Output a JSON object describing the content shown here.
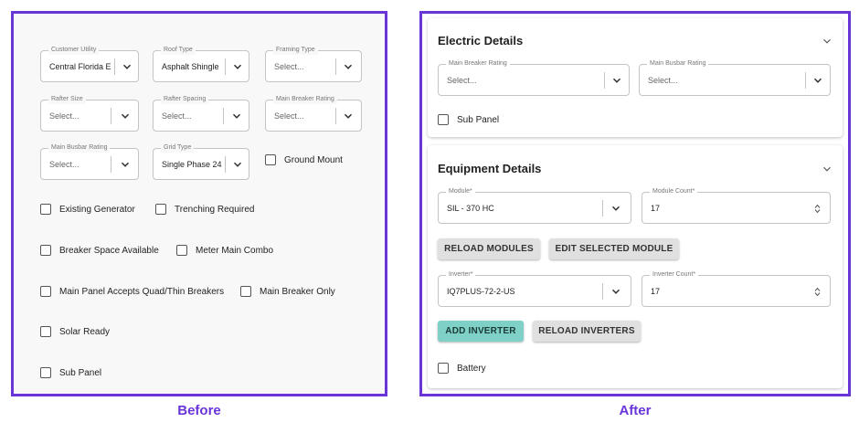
{
  "captions": {
    "before": "Before",
    "after": "After"
  },
  "before": {
    "selects": [
      {
        "label": "Customer Utility",
        "value": "Central Florida E..",
        "placeholder": false
      },
      {
        "label": "Roof Type",
        "value": "Asphalt Shingle",
        "placeholder": false
      },
      {
        "label": "Framing Type",
        "value": "Select...",
        "placeholder": true
      },
      {
        "label": "Rafter Size",
        "value": "Select...",
        "placeholder": true
      },
      {
        "label": "Rafter Spacing",
        "value": "Select...",
        "placeholder": true
      },
      {
        "label": "Main Breaker Rating",
        "value": "Select...",
        "placeholder": true
      },
      {
        "label": "Main Busbar Rating",
        "value": "Select...",
        "placeholder": true
      },
      {
        "label": "Grid Type",
        "value": "Single Phase 24..",
        "placeholder": false
      }
    ],
    "checkboxes": [
      "Ground Mount",
      "Existing Generator",
      "Trenching Required",
      "Breaker Space Available",
      "Meter Main Combo",
      "Main Panel Accepts Quad/Thin Breakers",
      "Main Breaker Only",
      "Solar Ready",
      "Sub Panel"
    ]
  },
  "after": {
    "electric": {
      "title": "Electric Details",
      "main_breaker": {
        "label": "Main Breaker Rating",
        "value": "Select..."
      },
      "main_busbar": {
        "label": "Main Busbar Rating",
        "value": "Select..."
      },
      "sub_panel": "Sub Panel"
    },
    "equipment": {
      "title": "Equipment Details",
      "module": {
        "label": "Module*",
        "value": "SIL - 370 HC"
      },
      "module_count": {
        "label": "Module Count*",
        "value": "17"
      },
      "reload_modules": "RELOAD MODULES",
      "edit_module": "EDIT SELECTED MODULE",
      "inverter": {
        "label": "Inverter*",
        "value": "IQ7PLUS-72-2-US"
      },
      "inverter_count": {
        "label": "Inverter Count*",
        "value": "17"
      },
      "add_inverter": "ADD INVERTER",
      "reload_inverters": "RELOAD INVERTERS",
      "battery": "Battery"
    }
  },
  "colors": {
    "frame": "#6a35d8",
    "primary_button": "#7fd1c8",
    "secondary_button": "#e0e0e0"
  }
}
